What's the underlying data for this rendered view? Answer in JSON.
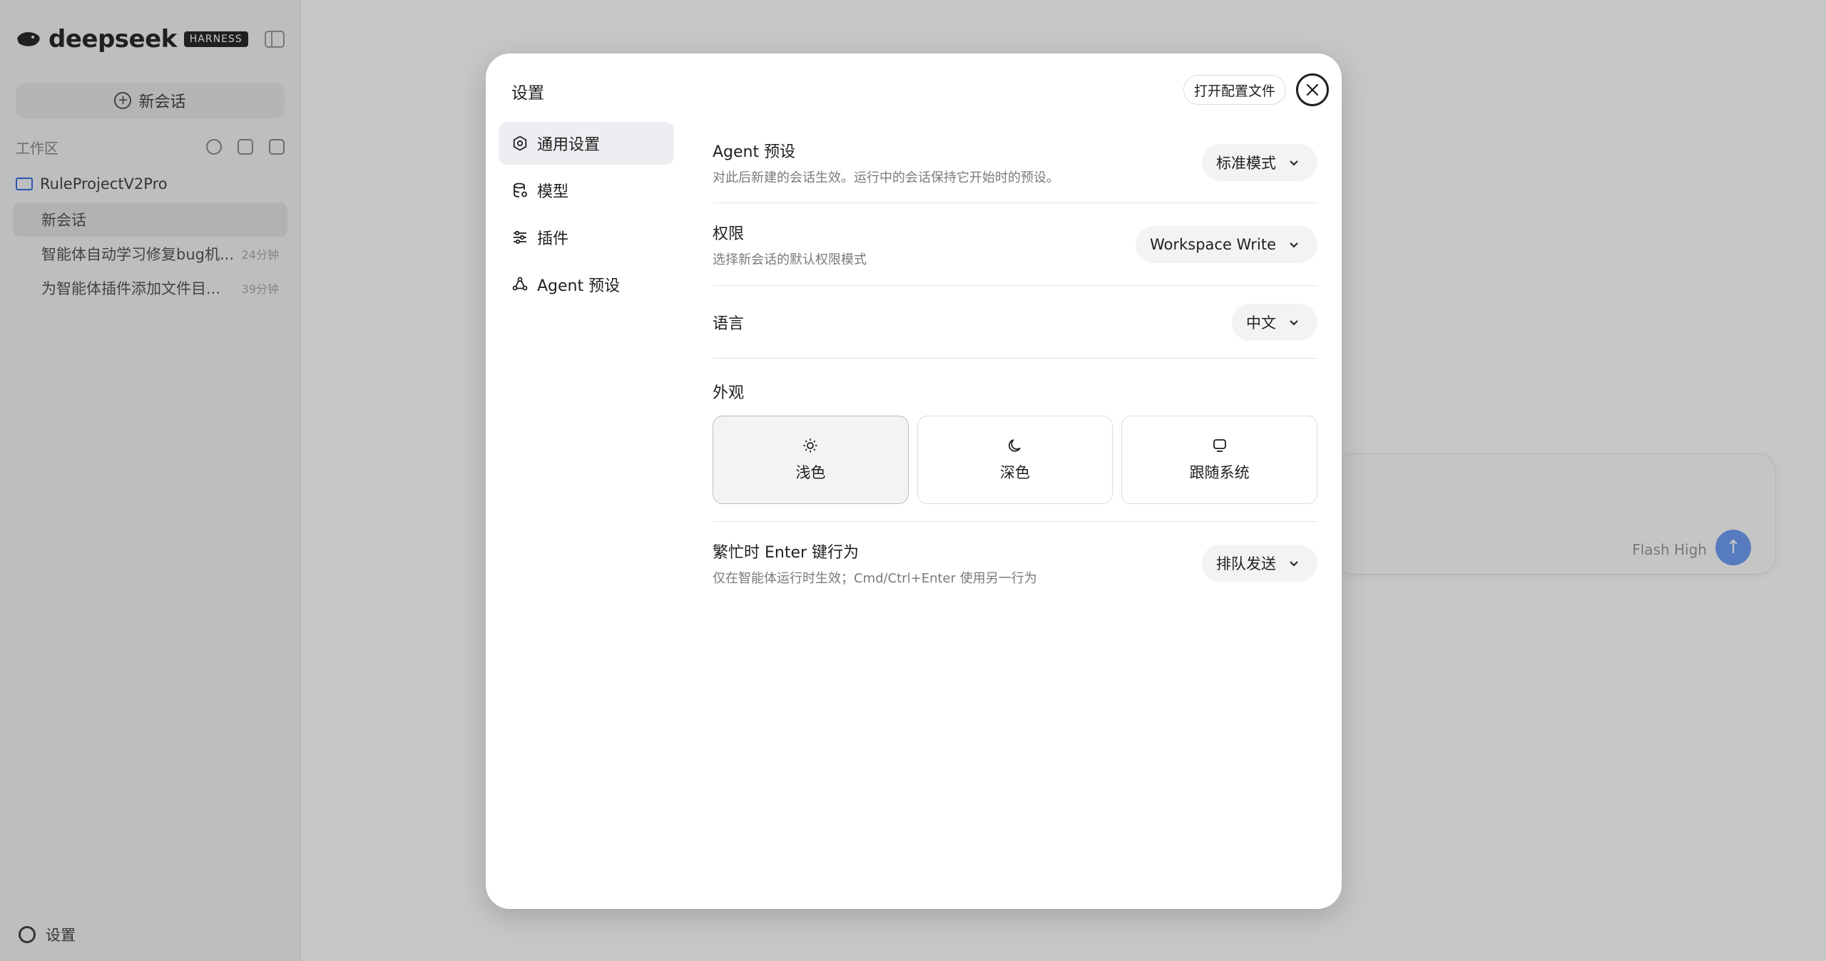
{
  "sidebar": {
    "brand": "deepseek",
    "badge": "HARNESS",
    "new_chat": "新会话",
    "workspace_label": "工作区",
    "project": "RuleProjectV2Pro",
    "sessions": [
      {
        "title": "新会话",
        "time": ""
      },
      {
        "title": "智能体自动学习修复bug机...",
        "time": "24分钟"
      },
      {
        "title": "为智能体插件添加文件目...",
        "time": "39分钟"
      }
    ],
    "settings_label": "设置"
  },
  "composer": {
    "model_text": "Flash High"
  },
  "settings": {
    "title": "设置",
    "open_config": "打开配置文件",
    "nav": [
      {
        "label": "通用设置",
        "icon": "gear-icon"
      },
      {
        "label": "模型",
        "icon": "database-icon"
      },
      {
        "label": "插件",
        "icon": "sliders-icon"
      },
      {
        "label": "Agent 预设",
        "icon": "recycle-icon"
      }
    ],
    "agent_preset": {
      "label": "Agent 预设",
      "desc": "对此后新建的会话生效。运行中的会话保持它开始时的预设。",
      "value": "标准模式"
    },
    "permission": {
      "label": "权限",
      "desc": "选择新会话的默认权限模式",
      "value": "Workspace Write"
    },
    "language": {
      "label": "语言",
      "value": "中文"
    },
    "appearance": {
      "label": "外观",
      "options": [
        {
          "label": "浅色",
          "icon": "sun-icon",
          "selected": true
        },
        {
          "label": "深色",
          "icon": "moon-icon",
          "selected": false
        },
        {
          "label": "跟随系统",
          "icon": "monitor-icon",
          "selected": false
        }
      ]
    },
    "busy_enter": {
      "label": "繁忙时 Enter 键行为",
      "desc": "仅在智能体运行时生效；Cmd/Ctrl+Enter 使用另一行为",
      "value": "排队发送"
    }
  }
}
